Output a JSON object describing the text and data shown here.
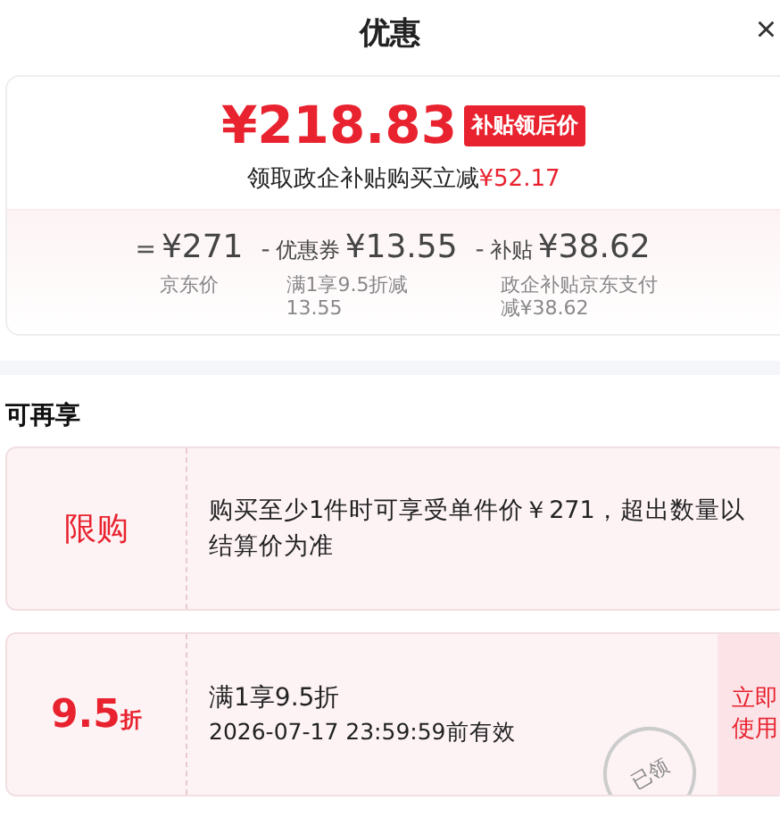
{
  "header": {
    "title": "优惠",
    "close": "×"
  },
  "price_card": {
    "price": "¥218.83",
    "badge": "补贴领后价",
    "note": "领取政企补贴购买立减",
    "note_amount": "¥52.17",
    "breakdown": [
      {
        "op": "=",
        "amount": "¥271",
        "desc": "京东价"
      },
      {
        "op": "-",
        "label": "优惠券",
        "amount": "¥13.55",
        "desc": "满1享9.5折减13.55"
      },
      {
        "op": "-",
        "label": "补贴",
        "amount": "¥38.62",
        "desc": "政企补贴京东支付减¥38.62"
      }
    ]
  },
  "section_title": "可再享",
  "offers": [
    {
      "kind": "limit",
      "tag": "限购",
      "text": "购买至少1件时可享受单件价￥271，超出数量以结算价为准"
    },
    {
      "kind": "discount",
      "value": "9.5",
      "unit": "折",
      "title": "满1享9.5折",
      "validity": "2026-07-17 23:59:59前有效",
      "action": "立即使用",
      "stamp": "已领"
    }
  ]
}
